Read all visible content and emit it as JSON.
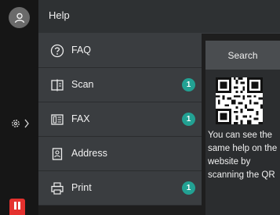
{
  "colors": {
    "background": "#1e1e1e",
    "header": "#2e3133",
    "list_item": "#3a3d40",
    "badge": "#22a193",
    "stop": "#e4312e"
  },
  "header": {
    "title": "Help"
  },
  "rail": {
    "user_icon": "user-icon",
    "settings_icon": "gear-icon",
    "stop_icon": "stop-icon"
  },
  "menu": {
    "items": [
      {
        "label": "FAQ",
        "icon": "help-circle-icon",
        "badge": ""
      },
      {
        "label": "Scan",
        "icon": "scan-icon",
        "badge": "1"
      },
      {
        "label": "FAX",
        "icon": "fax-icon",
        "badge": "1"
      },
      {
        "label": "Address",
        "icon": "address-book-icon",
        "badge": ""
      },
      {
        "label": "Print",
        "icon": "printer-icon",
        "badge": "1"
      }
    ]
  },
  "panel": {
    "search_label": "Search",
    "qr_icon": "qr-code-icon",
    "description": "You can see the same help on the website by scanning the QR"
  }
}
